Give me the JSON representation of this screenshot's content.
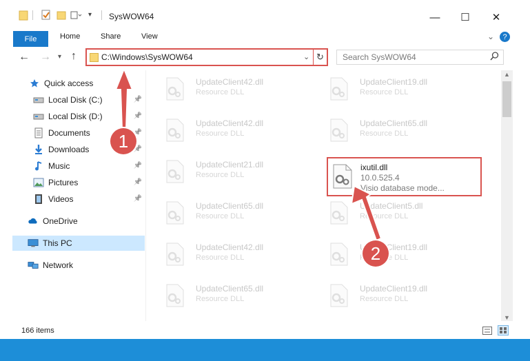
{
  "window": {
    "title": "SysWOW64",
    "minimize": "—",
    "maximize": "☐",
    "close": "✕"
  },
  "ribbon": {
    "tabs": [
      "File",
      "Home",
      "Share",
      "View"
    ],
    "collapse": "⌄",
    "help": "?"
  },
  "address": {
    "path": "C:\\Windows\\SysWOW64",
    "search_placeholder": "Search SysWOW64"
  },
  "nav": {
    "items": [
      {
        "label": "Quick access",
        "icon": "star-icon",
        "pinned": false
      },
      {
        "label": "Local Disk (C:)",
        "icon": "drive-icon",
        "pinned": true
      },
      {
        "label": "Local Disk (D:)",
        "icon": "drive-icon",
        "pinned": true
      },
      {
        "label": "Documents",
        "icon": "documents-icon",
        "pinned": true
      },
      {
        "label": "Downloads",
        "icon": "downloads-icon",
        "pinned": true
      },
      {
        "label": "Music",
        "icon": "music-icon",
        "pinned": true
      },
      {
        "label": "Pictures",
        "icon": "pictures-icon",
        "pinned": true
      },
      {
        "label": "Videos",
        "icon": "videos-icon",
        "pinned": true
      },
      {
        "label": "OneDrive",
        "icon": "onedrive-icon",
        "pinned": false
      },
      {
        "label": "This PC",
        "icon": "this-pc-icon",
        "pinned": false,
        "selected": true
      },
      {
        "label": "Network",
        "icon": "network-icon",
        "pinned": false
      }
    ]
  },
  "files": {
    "col1": [
      {
        "name": "UpdateClient42.dll",
        "desc": "Resource DLL"
      },
      {
        "name": "UpdateClient42.dll",
        "desc": "Resource DLL"
      },
      {
        "name": "UpdateClient21.dll",
        "desc": "Resource DLL"
      },
      {
        "name": "UpdateClient65.dll",
        "desc": "Resource DLL"
      },
      {
        "name": "UpdateClient42.dll",
        "desc": "Resource DLL"
      },
      {
        "name": "UpdateClient65.dll",
        "desc": "Resource DLL"
      }
    ],
    "col2": [
      {
        "name": "UpdateClient19.dll",
        "desc": "Resource DLL"
      },
      {
        "name": "UpdateClient65.dll",
        "desc": "Resource DLL"
      },
      {
        "name": "UpdateClient5.dll",
        "desc": "Resource DLL"
      },
      {
        "name": "UpdateClient19.dll",
        "desc": "Resource DLL"
      },
      {
        "name": "UpdateClient19.dll",
        "desc": "Resource DLL"
      }
    ],
    "highlighted": {
      "name": "ixutil.dll",
      "version": "10.0.525.4",
      "desc": "Visio database mode..."
    }
  },
  "status": {
    "count": "166 items"
  },
  "annotations": {
    "step1": "1",
    "step2": "2",
    "color": "#d9534f"
  }
}
